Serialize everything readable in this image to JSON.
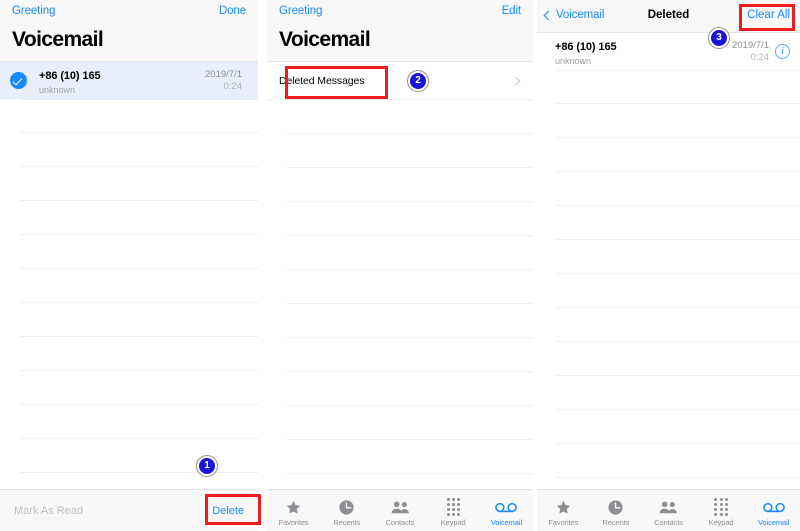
{
  "panels": [
    {
      "id": "panel-voicemail-edit",
      "nav": {
        "left_label": "Greeting",
        "right_label": "Done",
        "title": "Voicemail"
      },
      "row": {
        "number": "+86 (10) 165",
        "sub": "unknown",
        "date": "2019/7/1",
        "duration": "0:24"
      },
      "toolbar": {
        "mark_as_read": "Mark As Read",
        "delete": "Delete"
      }
    },
    {
      "id": "panel-voicemail-list",
      "nav": {
        "left_label": "Greeting",
        "right_label": "Edit",
        "title": "Voicemail"
      },
      "deleted_messages_label": "Deleted Messages"
    },
    {
      "id": "panel-deleted",
      "nav": {
        "back_label": "Voicemail",
        "title": "Deleted",
        "right_label": "Clear All"
      },
      "row": {
        "number": "+86 (10) 165",
        "sub": "unknown",
        "date": "2019/7/1",
        "duration": "0:24"
      }
    }
  ],
  "tabbar": {
    "items": [
      {
        "label": "Favorites",
        "icon": "star-icon",
        "active": false
      },
      {
        "label": "Recents",
        "icon": "clock-icon",
        "active": false
      },
      {
        "label": "Contacts",
        "icon": "people-icon",
        "active": false
      },
      {
        "label": "Keypad",
        "icon": "keypad-icon",
        "active": false
      },
      {
        "label": "Voicemail",
        "icon": "voicemail-icon",
        "active": true
      }
    ]
  },
  "annotations": {
    "step1": "1",
    "step2": "2",
    "step3": "3"
  },
  "colors": {
    "accent_blue": "#1789fc",
    "highlight_red": "#ee1c1c",
    "badge_blue": "#1a14d6",
    "selected_row": "#e8eefb"
  }
}
